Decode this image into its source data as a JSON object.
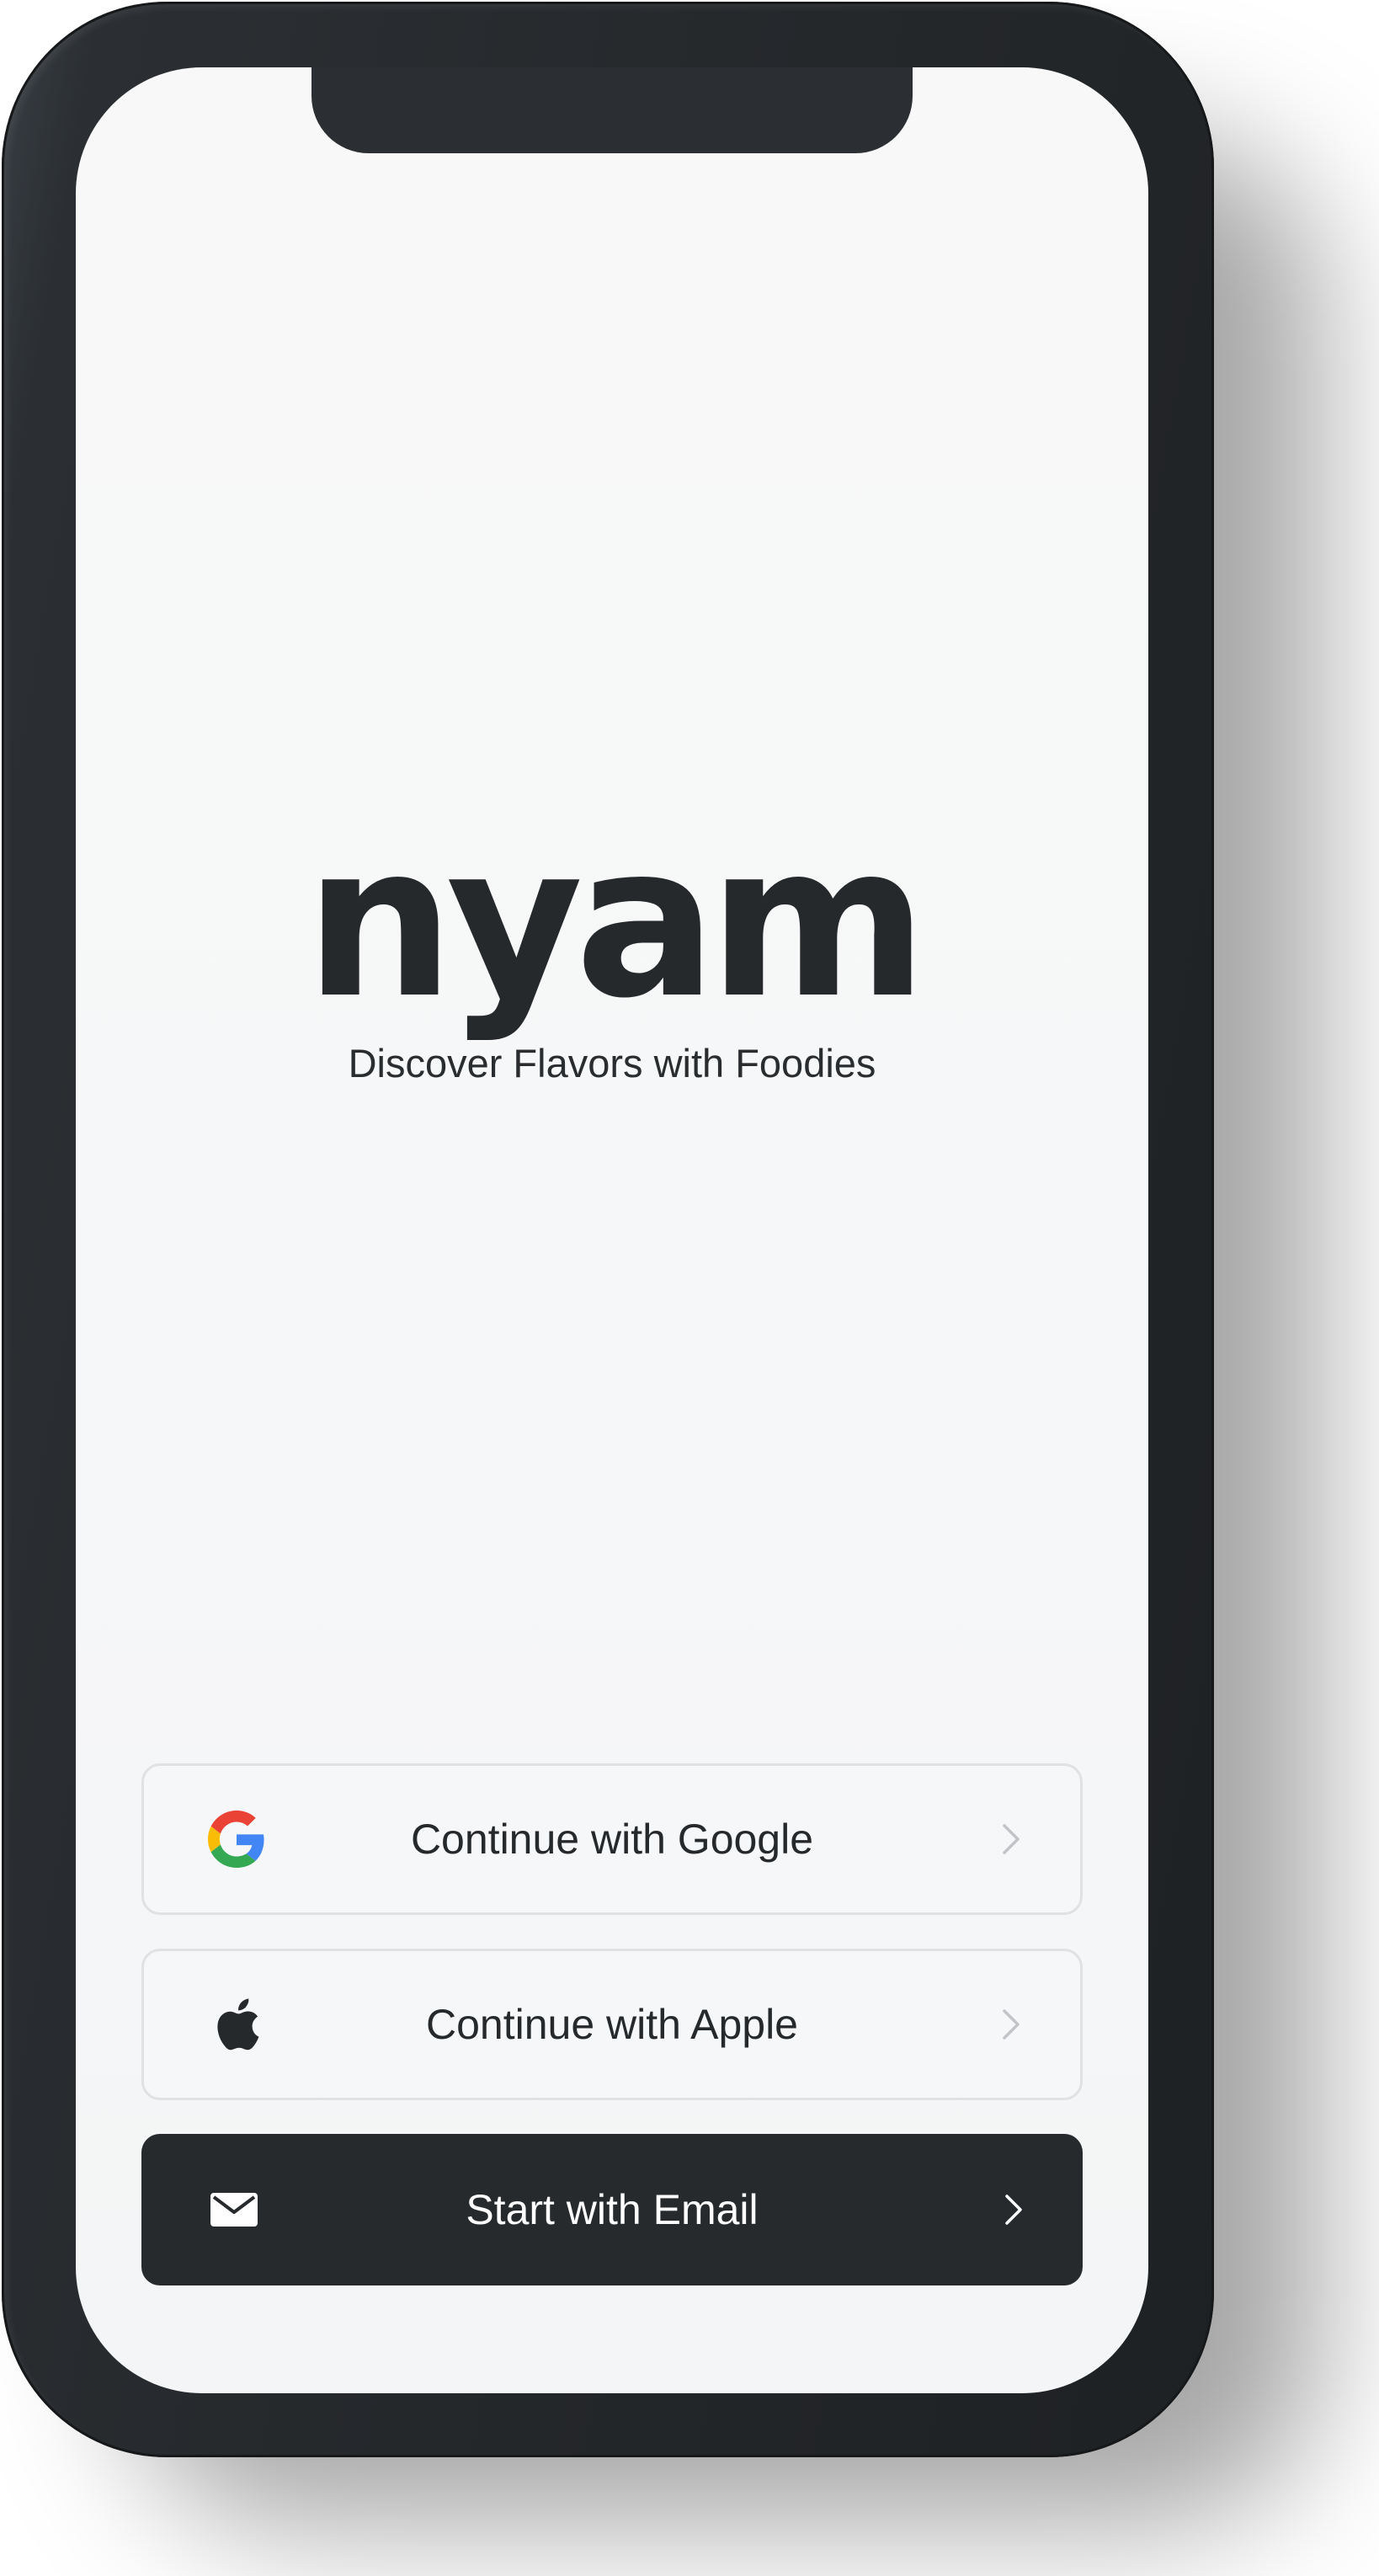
{
  "app": {
    "logo": "nyam",
    "tagline": "Discover Flavors with Foodies"
  },
  "buttons": [
    {
      "label": "Continue with Google",
      "icon": "google-icon"
    },
    {
      "label": "Continue with Apple",
      "icon": "apple-icon"
    },
    {
      "label": "Start with Email",
      "icon": "mail-icon"
    }
  ],
  "colors": {
    "frame": "#26292c",
    "screen_bg": "#f6f7f8",
    "primary_button": "#262a2d",
    "primary_text": "#ffffff",
    "text": "#26292c",
    "google_blue": "#4285F4",
    "google_red": "#EA4335",
    "google_yellow": "#FBBC05",
    "google_green": "#34A853"
  }
}
